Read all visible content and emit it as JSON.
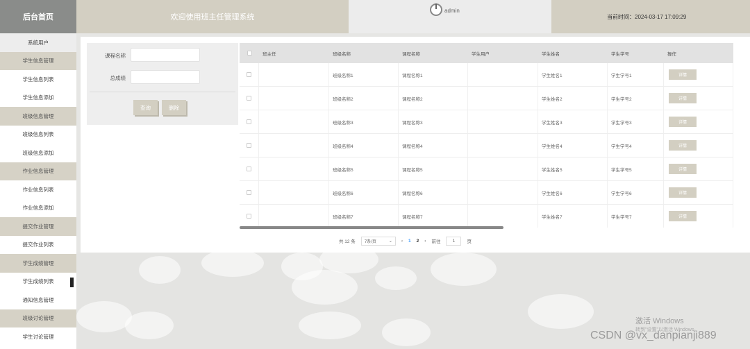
{
  "header": {
    "logo": "后台首页",
    "title": "欢迎使用班主任管理系统",
    "username": "admin",
    "time": "当前时间：2024-03-17 17:09:29"
  },
  "sidebar": {
    "items": [
      {
        "label": "系统用户",
        "type": "item"
      },
      {
        "label": "学生信息管理",
        "type": "group"
      },
      {
        "label": "学生信息列表",
        "type": "item"
      },
      {
        "label": "学生信息添加",
        "type": "item"
      },
      {
        "label": "班级信息管理",
        "type": "group"
      },
      {
        "label": "班级信息列表",
        "type": "item"
      },
      {
        "label": "班级信息添加",
        "type": "item"
      },
      {
        "label": "作业信息管理",
        "type": "group"
      },
      {
        "label": "作业信息列表",
        "type": "item"
      },
      {
        "label": "作业信息添加",
        "type": "item"
      },
      {
        "label": "提交作业管理",
        "type": "group"
      },
      {
        "label": "提交作业列表",
        "type": "item"
      },
      {
        "label": "学生成绩管理",
        "type": "group"
      },
      {
        "label": "学生成绩列表",
        "type": "item"
      },
      {
        "label": "通知信息管理",
        "type": "item"
      },
      {
        "label": "班级讨论管理",
        "type": "group"
      },
      {
        "label": "学生讨论管理",
        "type": "item"
      }
    ]
  },
  "search": {
    "course_label": "课程名称",
    "score_label": "总成绩",
    "query_btn": "查询",
    "delete_btn": "删除"
  },
  "table": {
    "headers": [
      "班主任",
      "班级名称",
      "课程名称",
      "学生用户",
      "学生姓名",
      "学生学号",
      "操作"
    ],
    "rows": [
      {
        "teacher": "",
        "class": "班级名称1",
        "course": "课程名称1",
        "user": "",
        "name": "学生姓名1",
        "sid": "学生学号1"
      },
      {
        "teacher": "",
        "class": "班级名称2",
        "course": "课程名称2",
        "user": "",
        "name": "学生姓名2",
        "sid": "学生学号2"
      },
      {
        "teacher": "",
        "class": "班级名称3",
        "course": "课程名称3",
        "user": "",
        "name": "学生姓名3",
        "sid": "学生学号3"
      },
      {
        "teacher": "",
        "class": "班级名称4",
        "course": "课程名称4",
        "user": "",
        "name": "学生姓名4",
        "sid": "学生学号4"
      },
      {
        "teacher": "",
        "class": "班级名称5",
        "course": "课程名称5",
        "user": "",
        "name": "学生姓名5",
        "sid": "学生学号5"
      },
      {
        "teacher": "",
        "class": "班级名称6",
        "course": "课程名称6",
        "user": "",
        "name": "学生姓名6",
        "sid": "学生学号6"
      },
      {
        "teacher": "",
        "class": "班级名称7",
        "course": "课程名称7",
        "user": "",
        "name": "学生姓名7",
        "sid": "学生学号7"
      }
    ],
    "detail_btn": "详情"
  },
  "pager": {
    "total": "共 12 条",
    "page_size": "7条/页",
    "prev": "‹",
    "pages": [
      "1",
      "2"
    ],
    "next": "›",
    "goto": "前往",
    "goto_value": "1",
    "page_unit": "页"
  },
  "watermark": {
    "title": "激活 Windows",
    "subtitle": "转到\"设置\"以激活 Windows。",
    "csdn": "CSDN @vx_danpianji889"
  },
  "colors": {
    "accent": "#d3cfc2",
    "logo_bg": "#8a8c8a",
    "active_page": "#409eff"
  }
}
